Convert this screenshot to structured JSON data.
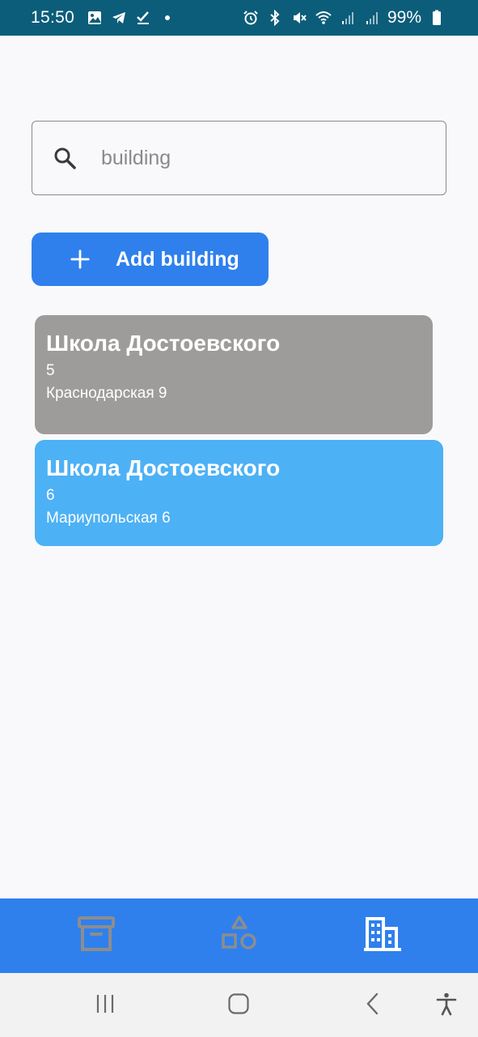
{
  "status_bar": {
    "time": "15:50",
    "battery": "99%",
    "left_icons": [
      "gallery-icon",
      "telegram-icon",
      "check-icon"
    ],
    "right_icons": [
      "alarm-icon",
      "bluetooth-icon",
      "mute-icon",
      "wifi-icon",
      "signal-icon",
      "signal-icon",
      "battery-icon"
    ]
  },
  "search": {
    "placeholder": "building",
    "value": ""
  },
  "add_button": {
    "label": "Add building"
  },
  "buildings": [
    {
      "title": "Школа Достоевского",
      "number": "5",
      "address": "Краснодарская 9",
      "color": "#9e9c9a"
    },
    {
      "title": "Школа Достоевского",
      "number": "6",
      "address": "Мариупольская 6",
      "color": "#4db1f5"
    }
  ],
  "bottom_nav": {
    "items": [
      "archive-icon",
      "shapes-icon",
      "building-icon"
    ],
    "active": "building-icon",
    "background": "#2f80ed"
  },
  "colors": {
    "status_bar": "#0b5d7a",
    "accent": "#2f80ed"
  }
}
